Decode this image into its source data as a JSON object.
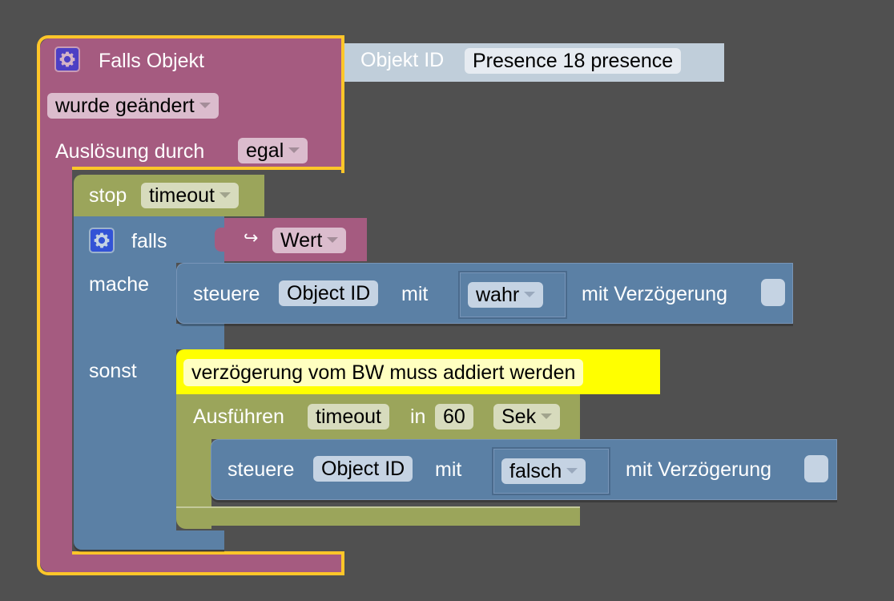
{
  "colors": {
    "background": "#505050",
    "event_block": "#a55b80",
    "logic_block": "#5b80a5",
    "timer_block": "#9ba55b",
    "comment_block": "#ffff00",
    "selection_outline": "#ffc629",
    "object_id_block": "#c0ceda"
  },
  "event_block": {
    "icon": "gear-icon",
    "title": "Falls Objekt",
    "trigger_dropdown": "wurde geändert",
    "trigger_by_label": "Auslösung durch",
    "trigger_by_dropdown": "egal"
  },
  "object_id_block": {
    "label": "Objekt ID",
    "value": "Presence 18 presence"
  },
  "stop_block": {
    "label": "stop",
    "dropdown": "timeout"
  },
  "if_block": {
    "icon": "gear-icon",
    "if_label": "falls",
    "do_label": "mache",
    "else_label": "sonst"
  },
  "value_block": {
    "icon": "return-arrow-icon",
    "arrow_glyph": "↪",
    "dropdown": "Wert"
  },
  "control_block_1": {
    "label": "steuere",
    "object": "Object ID",
    "with_label": "mit",
    "value_dropdown": "wahr",
    "delay_label": "mit Verzögerung"
  },
  "comment_block": {
    "text": "verzögerung vom BW muss addiert werden"
  },
  "timeout_block": {
    "label": "Ausführen",
    "name": "timeout",
    "in_label": "in",
    "value": "60",
    "unit_dropdown": "Sek"
  },
  "control_block_2": {
    "label": "steuere",
    "object": "Object ID",
    "with_label": "mit",
    "value_dropdown": "falsch",
    "delay_label": "mit Verzögerung"
  }
}
